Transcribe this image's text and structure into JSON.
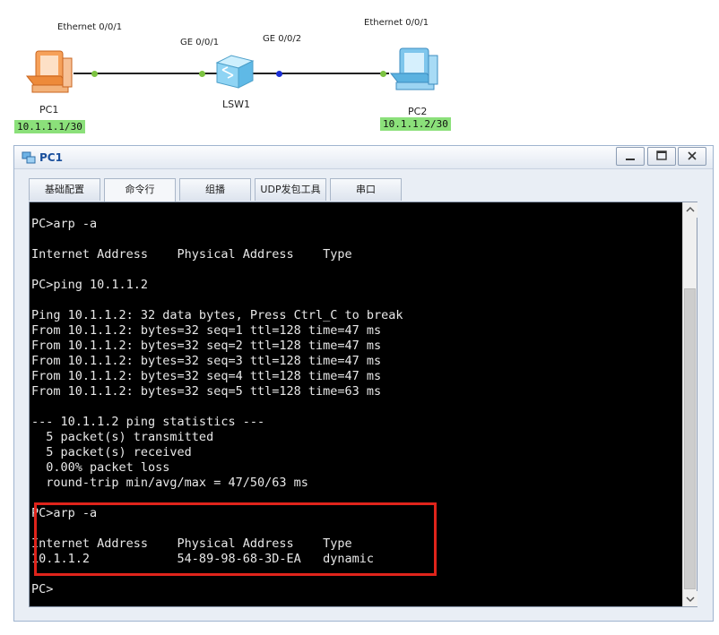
{
  "topology": {
    "pc1": {
      "name": "PC1",
      "ip": "10.1.1.1/30",
      "port": "Ethernet 0/0/1"
    },
    "pc2": {
      "name": "PC2",
      "ip": "10.1.1.2/30",
      "port": "Ethernet 0/0/1"
    },
    "lsw1": {
      "name": "LSW1",
      "port_left": "GE 0/0/1",
      "port_right": "GE 0/0/2"
    },
    "colors": {
      "link": "#222222",
      "port_up": "#7cc341",
      "port_blue": "#1a2fd6",
      "ip_tag_bg": "#8be07a"
    }
  },
  "window": {
    "title": "PC1",
    "tabs": [
      {
        "label": "基础配置"
      },
      {
        "label": "命令行"
      },
      {
        "label": "组播"
      },
      {
        "label": "UDP发包工具"
      },
      {
        "label": "串口"
      }
    ],
    "active_tab": "命令行"
  },
  "terminal": {
    "lines": [
      "PC>arp -a",
      "",
      "Internet Address    Physical Address    Type",
      "",
      "PC>ping 10.1.1.2",
      "",
      "Ping 10.1.1.2: 32 data bytes, Press Ctrl_C to break",
      "From 10.1.1.2: bytes=32 seq=1 ttl=128 time=47 ms",
      "From 10.1.1.2: bytes=32 seq=2 ttl=128 time=47 ms",
      "From 10.1.1.2: bytes=32 seq=3 ttl=128 time=47 ms",
      "From 10.1.1.2: bytes=32 seq=4 ttl=128 time=47 ms",
      "From 10.1.1.2: bytes=32 seq=5 ttl=128 time=63 ms",
      "",
      "--- 10.1.1.2 ping statistics ---",
      "  5 packet(s) transmitted",
      "  5 packet(s) received",
      "  0.00% packet loss",
      "  round-trip min/avg/max = 47/50/63 ms",
      "",
      "PC>arp -a",
      "",
      "Internet Address    Physical Address    Type",
      "10.1.1.2            54-89-98-68-3D-EA   dynamic",
      "",
      "PC>"
    ],
    "highlight_color": "#e0241b"
  }
}
